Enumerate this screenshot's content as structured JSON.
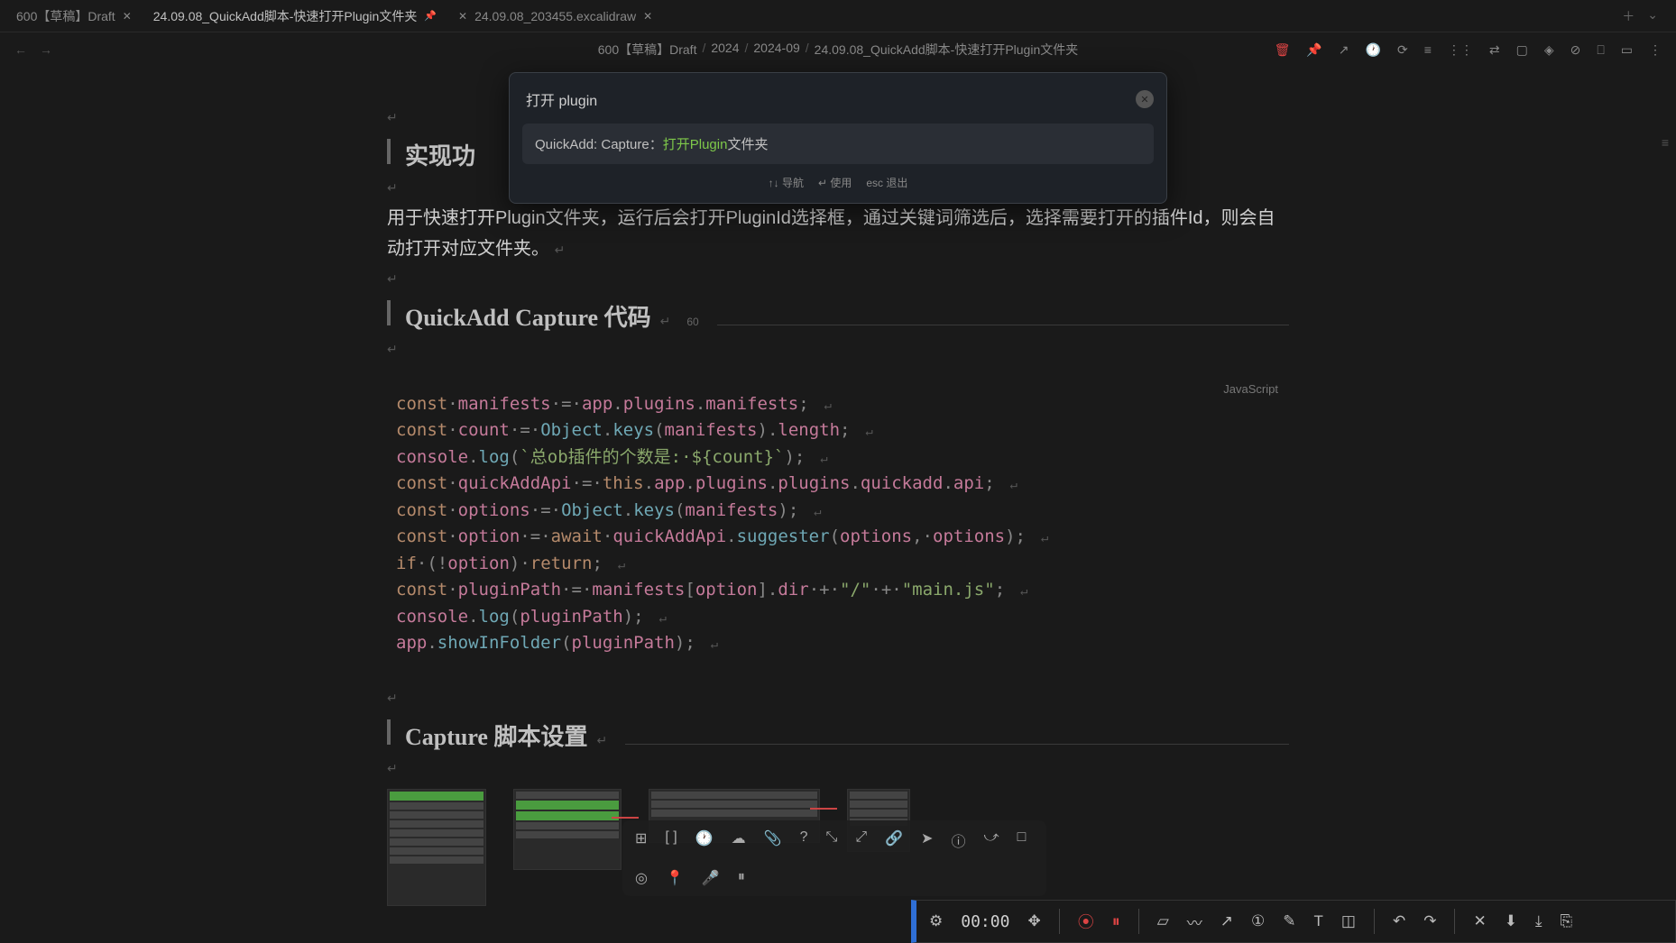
{
  "tabs": [
    {
      "title": "600【草稿】Draft",
      "active": false,
      "closable": true
    },
    {
      "title": "24.09.08_QuickAdd脚本-快速打开Plugin文件夹",
      "active": true,
      "pinned": true
    },
    {
      "title": "24.09.08_203455.excalidraw",
      "active": false,
      "icon": "✕",
      "closable": true
    }
  ],
  "breadcrumbs": [
    "600【草稿】Draft",
    "2024",
    "2024-09",
    "24.09.08_QuickAdd脚本-快速打开Plugin文件夹"
  ],
  "modal": {
    "input": "打开 plugin",
    "result_prefix": "QuickAdd: Capture：",
    "result_highlight": "打开Plugin",
    "result_suffix": "文件夹",
    "footer": {
      "nav": "↑↓ 导航",
      "use": "↵ 使用",
      "exit": "esc 退出"
    }
  },
  "headings": {
    "h1": "实现功",
    "h2": "QuickAdd Capture 代码",
    "h2_badge": "60",
    "h3": "Capture 脚本设置"
  },
  "body_p1": "用于快速打开Plugin文件夹，运行后会打开PluginId选择框，通过关键词筛选后，选择需要打开的插件Id，则会自动打开对应文件夹。",
  "code": {
    "lang": "JavaScript",
    "lines": [
      [
        [
          "kw",
          "const"
        ],
        [
          "dot",
          "·"
        ],
        [
          "var",
          "manifests"
        ],
        [
          "dot",
          "·"
        ],
        [
          "op",
          "="
        ],
        [
          "dot",
          "·"
        ],
        [
          "var",
          "app"
        ],
        [
          "punc",
          "."
        ],
        [
          "prop",
          "plugins"
        ],
        [
          "punc",
          "."
        ],
        [
          "prop",
          "manifests"
        ],
        [
          "punc",
          ";"
        ]
      ],
      [
        [
          "kw",
          "const"
        ],
        [
          "dot",
          "·"
        ],
        [
          "var",
          "count"
        ],
        [
          "dot",
          "·"
        ],
        [
          "op",
          "="
        ],
        [
          "dot",
          "·"
        ],
        [
          "obj",
          "Object"
        ],
        [
          "punc",
          "."
        ],
        [
          "fn",
          "keys"
        ],
        [
          "punc",
          "("
        ],
        [
          "var",
          "manifests"
        ],
        [
          "punc",
          ")"
        ],
        [
          "punc",
          "."
        ],
        [
          "prop",
          "length"
        ],
        [
          "punc",
          ";"
        ]
      ],
      [
        [
          "var",
          "console"
        ],
        [
          "punc",
          "."
        ],
        [
          "fn",
          "log"
        ],
        [
          "punc",
          "("
        ],
        [
          "str",
          "`总ob插件的个数是:·${count}`"
        ],
        [
          "punc",
          ")"
        ],
        [
          "punc",
          ";"
        ]
      ],
      [
        [
          "kw",
          "const"
        ],
        [
          "dot",
          "·"
        ],
        [
          "var",
          "quickAddApi"
        ],
        [
          "dot",
          "·"
        ],
        [
          "op",
          "="
        ],
        [
          "dot",
          "·"
        ],
        [
          "this",
          "this"
        ],
        [
          "punc",
          "."
        ],
        [
          "prop",
          "app"
        ],
        [
          "punc",
          "."
        ],
        [
          "prop",
          "plugins"
        ],
        [
          "punc",
          "."
        ],
        [
          "prop",
          "plugins"
        ],
        [
          "punc",
          "."
        ],
        [
          "prop",
          "quickadd"
        ],
        [
          "punc",
          "."
        ],
        [
          "prop",
          "api"
        ],
        [
          "punc",
          ";"
        ]
      ],
      [
        [
          "kw",
          "const"
        ],
        [
          "dot",
          "·"
        ],
        [
          "var",
          "options"
        ],
        [
          "dot",
          "·"
        ],
        [
          "op",
          "="
        ],
        [
          "dot",
          "·"
        ],
        [
          "obj",
          "Object"
        ],
        [
          "punc",
          "."
        ],
        [
          "fn",
          "keys"
        ],
        [
          "punc",
          "("
        ],
        [
          "var",
          "manifests"
        ],
        [
          "punc",
          ")"
        ],
        [
          "punc",
          ";"
        ]
      ],
      [
        [
          "kw",
          "const"
        ],
        [
          "dot",
          "·"
        ],
        [
          "var",
          "option"
        ],
        [
          "dot",
          "·"
        ],
        [
          "op",
          "="
        ],
        [
          "dot",
          "·"
        ],
        [
          "kw",
          "await"
        ],
        [
          "dot",
          "·"
        ],
        [
          "var",
          "quickAddApi"
        ],
        [
          "punc",
          "."
        ],
        [
          "fn",
          "suggester"
        ],
        [
          "punc",
          "("
        ],
        [
          "var",
          "options"
        ],
        [
          "punc",
          ","
        ],
        [
          "dot",
          "·"
        ],
        [
          "var",
          "options"
        ],
        [
          "punc",
          ")"
        ],
        [
          "punc",
          ";"
        ]
      ],
      [
        [
          "kw",
          "if"
        ],
        [
          "dot",
          "·"
        ],
        [
          "punc",
          "("
        ],
        [
          "op",
          "!"
        ],
        [
          "var",
          "option"
        ],
        [
          "punc",
          ")"
        ],
        [
          "dot",
          "·"
        ],
        [
          "kw",
          "return"
        ],
        [
          "punc",
          ";"
        ]
      ],
      [
        [
          "kw",
          "const"
        ],
        [
          "dot",
          "·"
        ],
        [
          "var",
          "pluginPath"
        ],
        [
          "dot",
          "·"
        ],
        [
          "op",
          "="
        ],
        [
          "dot",
          "·"
        ],
        [
          "var",
          "manifests"
        ],
        [
          "punc",
          "["
        ],
        [
          "var",
          "option"
        ],
        [
          "punc",
          "]"
        ],
        [
          "punc",
          "."
        ],
        [
          "prop",
          "dir"
        ],
        [
          "dot",
          "·"
        ],
        [
          "op",
          "+"
        ],
        [
          "dot",
          "·"
        ],
        [
          "str",
          "\"/\""
        ],
        [
          "dot",
          "·"
        ],
        [
          "op",
          "+"
        ],
        [
          "dot",
          "·"
        ],
        [
          "str",
          "\"main.js\""
        ],
        [
          "punc",
          ";"
        ]
      ],
      [
        [
          "var",
          "console"
        ],
        [
          "punc",
          "."
        ],
        [
          "fn",
          "log"
        ],
        [
          "punc",
          "("
        ],
        [
          "var",
          "pluginPath"
        ],
        [
          "punc",
          ")"
        ],
        [
          "punc",
          ";"
        ]
      ],
      [
        [
          "var",
          "app"
        ],
        [
          "punc",
          "."
        ],
        [
          "fn",
          "showInFolder"
        ],
        [
          "punc",
          "("
        ],
        [
          "var",
          "pluginPath"
        ],
        [
          "punc",
          ")"
        ],
        [
          "punc",
          ";"
        ]
      ]
    ]
  },
  "recorder": {
    "time": "00:00"
  }
}
